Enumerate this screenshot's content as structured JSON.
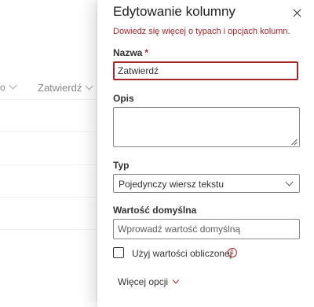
{
  "background": {
    "partial_column": "o",
    "column": "Zatwierdź"
  },
  "panel": {
    "title": "Edytowanie kolumny",
    "learn_more": "Dowiedz się więcej o typach i opcjach kolumn.",
    "name": {
      "label": "Nazwa",
      "required_mark": "*",
      "value": "Zatwierdź"
    },
    "description": {
      "label": "Opis",
      "value": ""
    },
    "type": {
      "label": "Typ",
      "selected": "Pojedynczy wiersz tekstu"
    },
    "default_value": {
      "label": "Wartość domyślna",
      "placeholder": "Wprowadź wartość domyślną",
      "value": ""
    },
    "calculated": {
      "label": "Użyj wartości obliczonej",
      "checked": false,
      "info_glyph": "i"
    },
    "more_options": "Więcej opcji"
  },
  "colors": {
    "accent": "#a4262c",
    "text": "#323130",
    "border": "#8a8886"
  }
}
